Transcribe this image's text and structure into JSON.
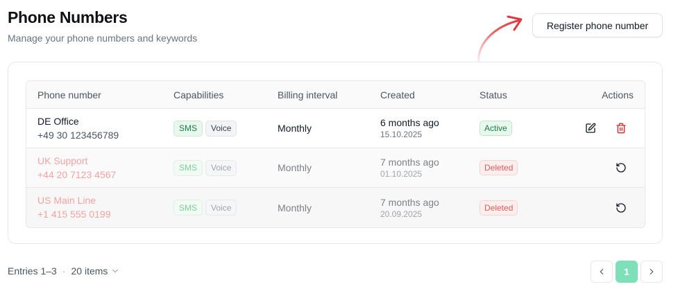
{
  "header": {
    "title": "Phone Numbers",
    "subtitle": "Manage your phone numbers and keywords",
    "register_label": "Register phone number"
  },
  "table": {
    "columns": [
      "Phone number",
      "Capabilities",
      "Billing interval",
      "Created",
      "Status",
      "Actions"
    ],
    "rows": [
      {
        "name": "DE Office",
        "number": "+49 30 123456789",
        "caps": [
          "SMS",
          "Voice"
        ],
        "billing": "Monthly",
        "created_rel": "6 months ago",
        "created_abs": "15.10.2025",
        "status": "Active"
      },
      {
        "name": "UK Support",
        "number": "+44 20 7123 4567",
        "caps": [
          "SMS",
          "Voice"
        ],
        "billing": "Monthly",
        "created_rel": "7 months ago",
        "created_abs": "01.10.2025",
        "status": "Deleted"
      },
      {
        "name": "US Main Line",
        "number": "+1 415 555 0199",
        "caps": [
          "SMS",
          "Voice"
        ],
        "billing": "Monthly",
        "created_rel": "7 months ago",
        "created_abs": "20.09.2025",
        "status": "Deleted"
      }
    ]
  },
  "footer": {
    "entries": "Entries 1–3",
    "separator": "·",
    "items_label": "20 items",
    "current_page": "1"
  },
  "colors": {
    "accent": "#7de0b8",
    "arrow": "#e0393e",
    "active": "#15803d",
    "deleted": "#e05b5b"
  },
  "icons": [
    "edit-icon",
    "trash-icon",
    "restore-icon",
    "chevron-left-icon",
    "chevron-right-icon",
    "chevron-down-icon"
  ]
}
